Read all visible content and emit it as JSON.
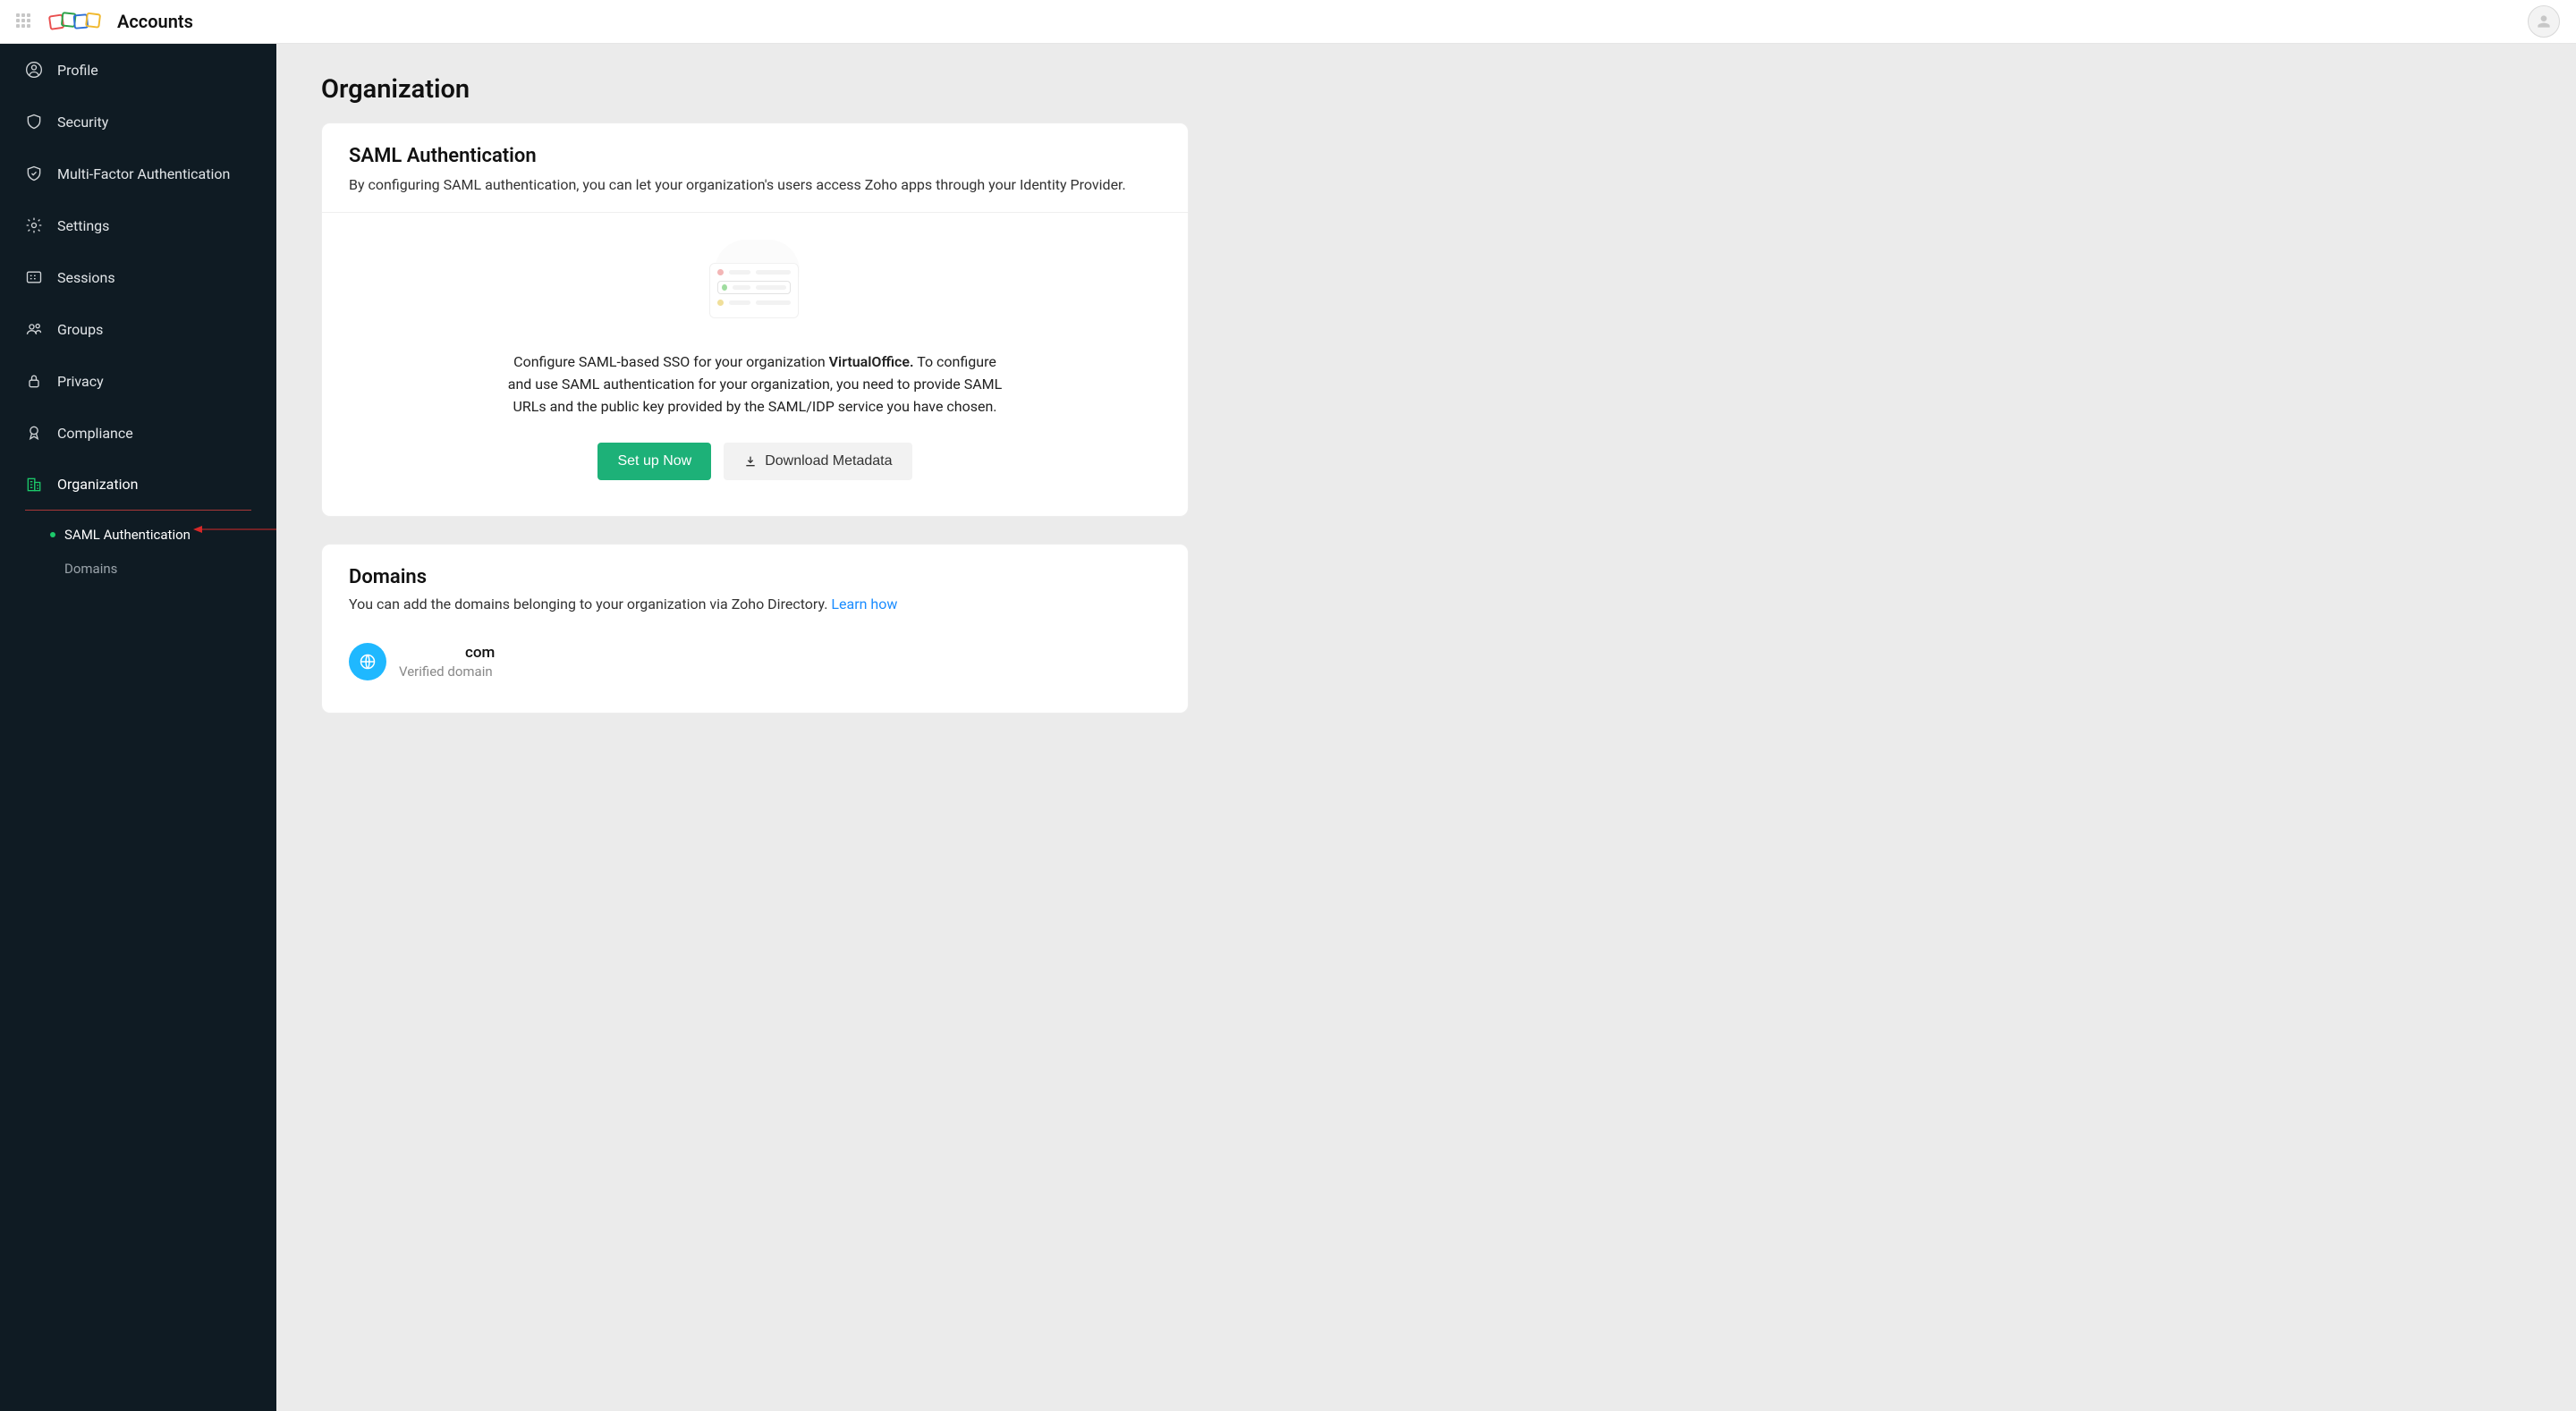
{
  "app_name": "Accounts",
  "page_title": "Organization",
  "nav": [
    {
      "label": "Profile"
    },
    {
      "label": "Security"
    },
    {
      "label": "Multi-Factor Authentication"
    },
    {
      "label": "Settings"
    },
    {
      "label": "Sessions"
    },
    {
      "label": "Groups"
    },
    {
      "label": "Privacy"
    },
    {
      "label": "Compliance"
    },
    {
      "label": "Organization"
    }
  ],
  "sub_nav": [
    {
      "label": "SAML Authentication"
    },
    {
      "label": "Domains"
    }
  ],
  "saml": {
    "title": "SAML Authentication",
    "subtitle": "By configuring SAML authentication, you can let your organization's users access Zoho apps through your Identity Provider.",
    "desc_pre": "Configure SAML-based SSO for your organization ",
    "org_name": "VirtualOffice.",
    "desc_post": " To configure and use SAML authentication for your organization, you need to provide SAML URLs and the public key provided by the SAML/IDP service you have chosen.",
    "setup_label": "Set up Now",
    "download_label": "Download Metadata"
  },
  "domains": {
    "title": "Domains",
    "subtitle": "You can add the domains belonging to your organization via Zoho Directory. ",
    "learn_how": "Learn how",
    "domain_suffix": "com",
    "verified_label": "Verified domain"
  }
}
